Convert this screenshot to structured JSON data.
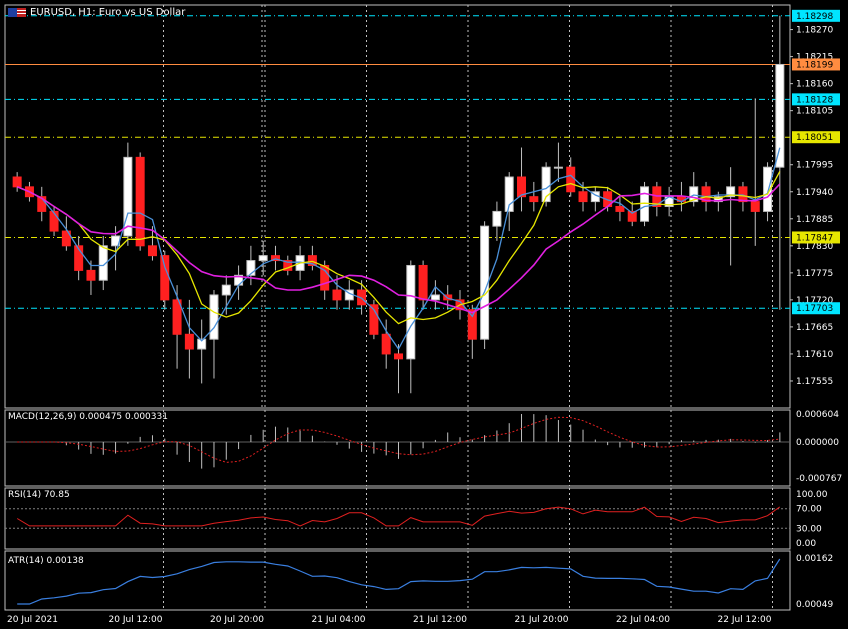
{
  "title": "EURUSD, H1:  Euro vs US Dollar",
  "colors": {
    "background": "#000000",
    "grid": "#c0c0c0",
    "bull": "#ffffff",
    "bear": "#ff2020",
    "ma_fast": "#4a90d9",
    "ma_mid": "#e6e600",
    "ma_slow": "#e020e0",
    "hline_cyan": "#00e5ff",
    "hline_orange": "#ff8c40",
    "hline_yellow": "#e6e600",
    "rsi": "#e02020",
    "atr": "#3a7fe0",
    "macd_signal": "#e02020",
    "macd_hist": "#c0c0c0"
  },
  "price_axis_labels": [
    "1.18270",
    "1.18215",
    "1.18160",
    "1.18105",
    "1.17995",
    "1.17940",
    "1.17885",
    "1.17830",
    "1.17775",
    "1.17720",
    "1.17665",
    "1.17610",
    "1.17555"
  ],
  "price_tags": [
    {
      "text": "1.18298",
      "style": "cyan"
    },
    {
      "text": "1.18199",
      "style": "orange"
    },
    {
      "text": "1.18128",
      "style": "cyan"
    },
    {
      "text": "1.18051",
      "style": "yellow"
    },
    {
      "text": "1.17847",
      "style": "yellow"
    },
    {
      "text": "1.17703",
      "style": "cyan"
    }
  ],
  "time_labels": [
    "20 Jul 2021",
    "20 Jul 12:00",
    "20 Jul 20:00",
    "21 Jul 04:00",
    "21 Jul 12:00",
    "21 Jul 20:00",
    "22 Jul 04:00",
    "22 Jul 12:00"
  ],
  "macd": {
    "label": "MACD(12,26,9) 0.000475 0.000331",
    "axis": [
      "0.000604",
      "0.000000",
      "-0.000767"
    ]
  },
  "rsi": {
    "label": "RSI(14) 70.85",
    "axis": [
      "100.00",
      "70.00",
      "30.00",
      "0.00"
    ]
  },
  "atr": {
    "label": "ATR(14) 0.00138",
    "axis": [
      "0.00162",
      "0.00049"
    ]
  },
  "chart_data": {
    "type": "candlestick",
    "symbol": "EURUSD",
    "timeframe": "H1",
    "ylim": [
      1.175,
      1.1832
    ],
    "candles": [
      [
        1.1797,
        1.1798,
        1.1794,
        1.1795
      ],
      [
        1.1795,
        1.1796,
        1.1792,
        1.1793
      ],
      [
        1.1793,
        1.1795,
        1.1788,
        1.179
      ],
      [
        1.179,
        1.1791,
        1.1785,
        1.1786
      ],
      [
        1.1786,
        1.1789,
        1.1782,
        1.1783
      ],
      [
        1.1783,
        1.1785,
        1.1776,
        1.1778
      ],
      [
        1.1778,
        1.178,
        1.1773,
        1.1776
      ],
      [
        1.1776,
        1.1785,
        1.1774,
        1.1783
      ],
      [
        1.1783,
        1.1787,
        1.1778,
        1.1785
      ],
      [
        1.1785,
        1.1804,
        1.1783,
        1.1801
      ],
      [
        1.1801,
        1.1802,
        1.1782,
        1.1783
      ],
      [
        1.1783,
        1.1787,
        1.178,
        1.1781
      ],
      [
        1.1781,
        1.1782,
        1.177,
        1.1772
      ],
      [
        1.1772,
        1.1775,
        1.1758,
        1.1765
      ],
      [
        1.1765,
        1.1772,
        1.1756,
        1.1762
      ],
      [
        1.1762,
        1.1768,
        1.1755,
        1.1764
      ],
      [
        1.1764,
        1.1774,
        1.1756,
        1.1773
      ],
      [
        1.1773,
        1.1777,
        1.1769,
        1.1775
      ],
      [
        1.1775,
        1.1779,
        1.1772,
        1.1777
      ],
      [
        1.1777,
        1.1783,
        1.1775,
        1.178
      ],
      [
        1.178,
        1.1784,
        1.1777,
        1.1781
      ],
      [
        1.1781,
        1.1783,
        1.1778,
        1.178
      ],
      [
        1.178,
        1.1781,
        1.1777,
        1.1778
      ],
      [
        1.1778,
        1.1783,
        1.1776,
        1.1781
      ],
      [
        1.1781,
        1.1783,
        1.1778,
        1.1779
      ],
      [
        1.1779,
        1.178,
        1.1772,
        1.1774
      ],
      [
        1.1774,
        1.1777,
        1.177,
        1.1772
      ],
      [
        1.1772,
        1.1776,
        1.177,
        1.1774
      ],
      [
        1.1774,
        1.1776,
        1.1769,
        1.1771
      ],
      [
        1.1771,
        1.1772,
        1.1764,
        1.1765
      ],
      [
        1.1765,
        1.1768,
        1.1758,
        1.1761
      ],
      [
        1.1761,
        1.1763,
        1.1753,
        1.176
      ],
      [
        1.176,
        1.178,
        1.1753,
        1.1779
      ],
      [
        1.1779,
        1.178,
        1.177,
        1.1772
      ],
      [
        1.1772,
        1.1776,
        1.177,
        1.1773
      ],
      [
        1.1773,
        1.1775,
        1.177,
        1.1772
      ],
      [
        1.1772,
        1.1774,
        1.1768,
        1.177
      ],
      [
        1.177,
        1.1771,
        1.176,
        1.1764
      ],
      [
        1.1764,
        1.1788,
        1.1762,
        1.1787
      ],
      [
        1.1787,
        1.1792,
        1.1784,
        1.179
      ],
      [
        1.179,
        1.1798,
        1.1786,
        1.1797
      ],
      [
        1.1797,
        1.1803,
        1.179,
        1.1793
      ],
      [
        1.1793,
        1.1796,
        1.179,
        1.1792
      ],
      [
        1.1792,
        1.18,
        1.1791,
        1.1799
      ],
      [
        1.1799,
        1.1804,
        1.1796,
        1.1799
      ],
      [
        1.1799,
        1.1801,
        1.1793,
        1.1794
      ],
      [
        1.1794,
        1.1796,
        1.179,
        1.1792
      ],
      [
        1.1792,
        1.1795,
        1.179,
        1.1794
      ],
      [
        1.1794,
        1.1795,
        1.179,
        1.1791
      ],
      [
        1.1791,
        1.1793,
        1.1788,
        1.179
      ],
      [
        1.179,
        1.1792,
        1.1787,
        1.1788
      ],
      [
        1.1788,
        1.1796,
        1.1787,
        1.1795
      ],
      [
        1.1795,
        1.1796,
        1.1789,
        1.1791
      ],
      [
        1.1791,
        1.1795,
        1.1789,
        1.1793
      ],
      [
        1.1793,
        1.1796,
        1.179,
        1.1792
      ],
      [
        1.1792,
        1.1798,
        1.1791,
        1.1795
      ],
      [
        1.1795,
        1.1796,
        1.179,
        1.1792
      ],
      [
        1.1792,
        1.1794,
        1.179,
        1.1793
      ],
      [
        1.1793,
        1.1799,
        1.1779,
        1.1795
      ],
      [
        1.1795,
        1.1796,
        1.179,
        1.1792
      ],
      [
        1.1792,
        1.1813,
        1.1783,
        1.179
      ],
      [
        1.179,
        1.18,
        1.1788,
        1.1799
      ],
      [
        1.1799,
        1.18298,
        1.177,
        1.18199
      ]
    ]
  }
}
